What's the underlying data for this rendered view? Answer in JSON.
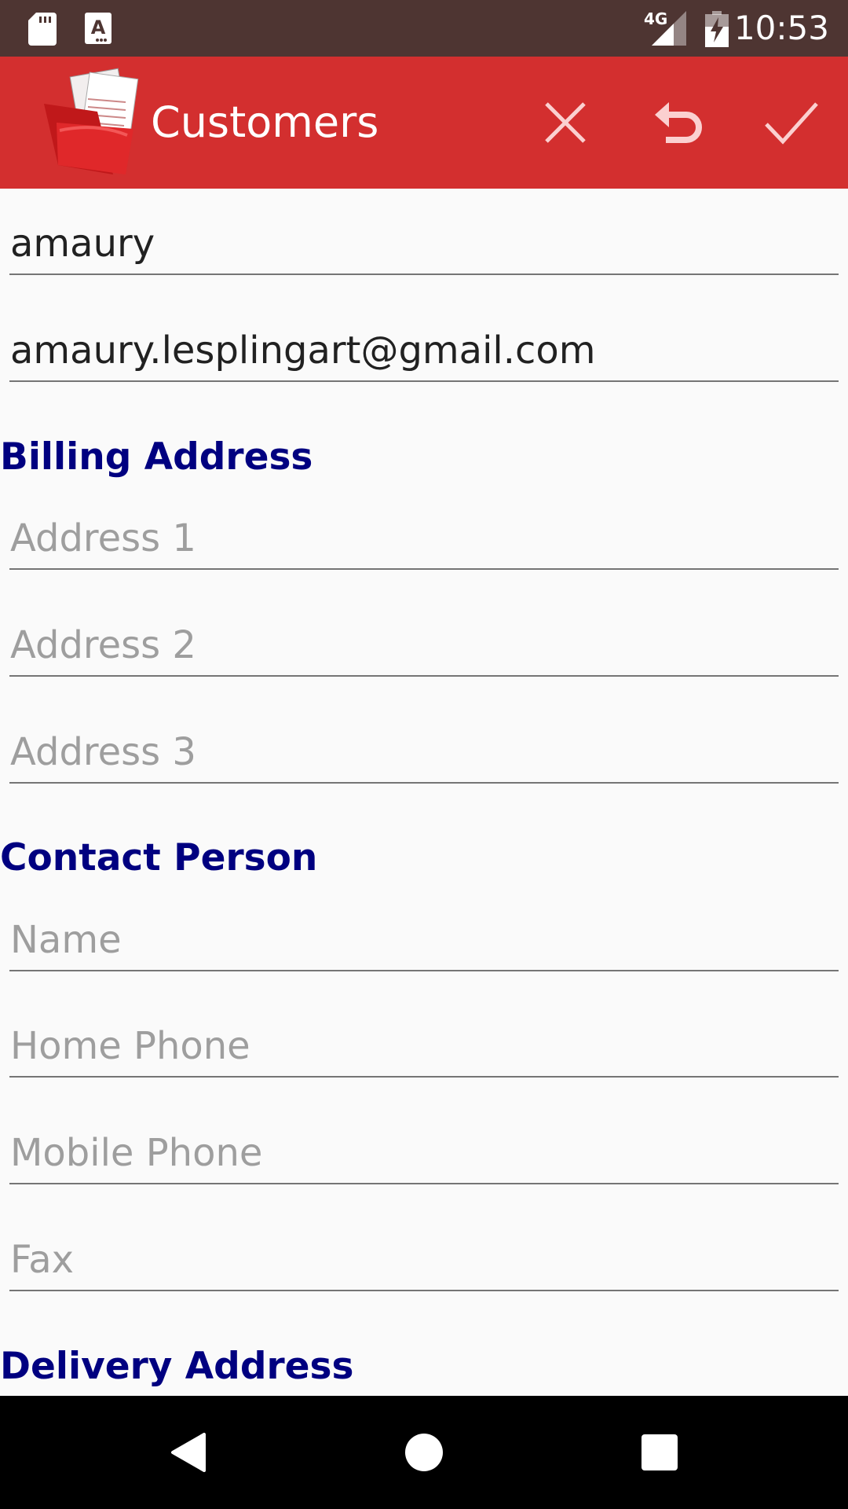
{
  "status_bar": {
    "time": "10:53",
    "network": "4G",
    "icons": [
      "sd-card-icon",
      "keyboard-a-icon",
      "signal-icon",
      "battery-charging-icon"
    ]
  },
  "toolbar": {
    "title": "Customers",
    "actions": [
      "close-icon",
      "undo-icon",
      "check-icon"
    ],
    "color": "#d32f2f"
  },
  "form": {
    "name_value": "amaury",
    "email_value": "amaury.lesplingart@gmail.com",
    "billing_heading": "Billing Address",
    "address1_placeholder": "Address 1",
    "address2_placeholder": "Address 2",
    "address3_placeholder": "Address 3",
    "contact_heading": "Contact Person",
    "contact_name_placeholder": "Name",
    "home_phone_placeholder": "Home Phone",
    "mobile_phone_placeholder": "Mobile Phone",
    "fax_placeholder": "Fax",
    "delivery_heading": "Delivery Address",
    "heading_color": "#000080"
  },
  "nav_bar": {
    "buttons": [
      "back-icon",
      "home-icon",
      "recents-icon"
    ]
  }
}
